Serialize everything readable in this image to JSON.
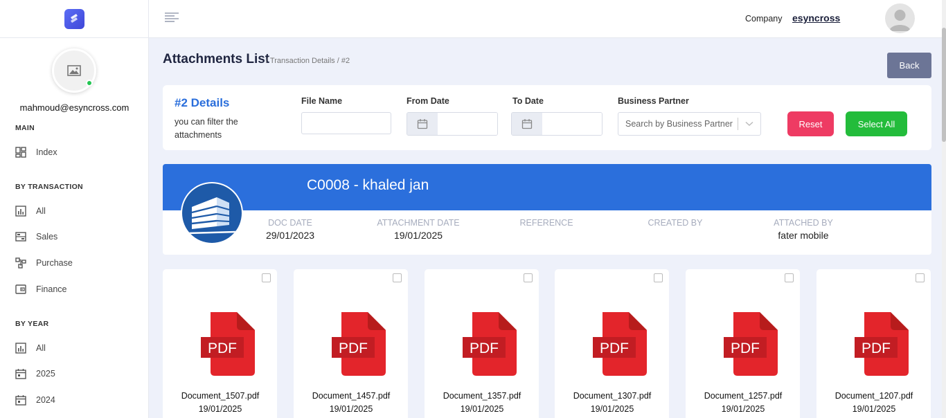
{
  "sidebar": {
    "user_email": "mahmoud@esyncross.com",
    "sections": {
      "main": "MAIN",
      "by_transaction": "BY TRANSACTION",
      "by_year": "BY YEAR"
    },
    "items": {
      "index": "Index",
      "tx_all": "All",
      "sales": "Sales",
      "purchase": "Purchase",
      "finance": "Finance",
      "year_all": "All",
      "y2025": "2025",
      "y2024": "2024"
    }
  },
  "topbar": {
    "company_label": "Company",
    "company_name": "esyncross"
  },
  "header": {
    "title": "Attachments List",
    "breadcrumb": "/ Transaction Details / #2",
    "back_label": "Back"
  },
  "filter": {
    "details_title": "#2 Details",
    "details_subtitle": "you can filter the attachments",
    "file_name_label": "File Name",
    "file_name_value": "",
    "from_date_label": "From Date",
    "from_date_value": "",
    "to_date_label": "To Date",
    "to_date_value": "",
    "bp_label": "Business Partner",
    "bp_placeholder": "Search by Business Partner",
    "reset_label": "Reset",
    "select_all_label": "Select All"
  },
  "transaction": {
    "title": "C0008 - khaled jan",
    "doc_date_label": "DOC DATE",
    "doc_date": "29/01/2023",
    "attachment_date_label": "ATTACHMENT DATE",
    "attachment_date": "19/01/2025",
    "reference_label": "REFERENCE",
    "reference": "",
    "created_by_label": "CREATED BY",
    "created_by": "",
    "attached_by_label": "ATTACHED BY",
    "attached_by": "fater mobile"
  },
  "documents": [
    {
      "name": "Document_1507.pdf",
      "date": "19/01/2025",
      "icon_text": "PDF"
    },
    {
      "name": "Document_1457.pdf",
      "date": "19/01/2025",
      "icon_text": "PDF"
    },
    {
      "name": "Document_1357.pdf",
      "date": "19/01/2025",
      "icon_text": "PDF"
    },
    {
      "name": "Document_1307.pdf",
      "date": "19/01/2025",
      "icon_text": "PDF"
    },
    {
      "name": "Document_1257.pdf",
      "date": "19/01/2025",
      "icon_text": "PDF"
    },
    {
      "name": "Document_1207.pdf",
      "date": "19/01/2025",
      "icon_text": "PDF"
    }
  ],
  "colors": {
    "accent": "#2b6fdc",
    "reset": "#ee3b63",
    "select_all": "#23bc3b",
    "back": "#6c7596",
    "pdf_red": "#e3252b"
  }
}
